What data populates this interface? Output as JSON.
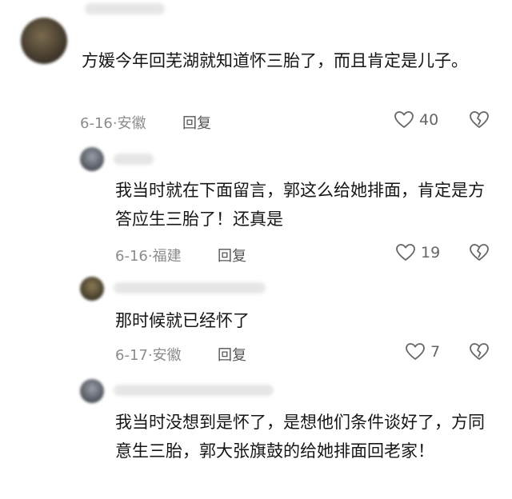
{
  "comments": [
    {
      "text": "方媛今年回芜湖就知道怀三胎了，而且肯定是儿子。",
      "date": "6-16",
      "location": "安徽",
      "reply_label": "回复",
      "likes": "40"
    },
    {
      "text": "我当时就在下面留言，郭这么给她排面，肯定是方答应生三胎了！还真是",
      "date": "6-16",
      "location": "福建",
      "reply_label": "回复",
      "likes": "19"
    },
    {
      "text": "那时候就已经怀了",
      "date": "6-17",
      "location": "安徽",
      "reply_label": "回复",
      "likes": "7"
    },
    {
      "text": "我当时没想到是怀了，是想他们条件谈好了，方同意生三胎，郭大张旗鼓的给她排面回老家！"
    }
  ],
  "icons": {
    "like": "heart-outline-icon",
    "dislike": "broken-heart-icon"
  },
  "colors": {
    "text": "#161616",
    "meta": "#8c8c8c",
    "icon": "#666666"
  }
}
